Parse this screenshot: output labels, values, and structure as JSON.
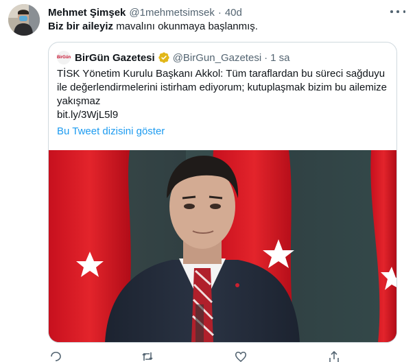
{
  "tweet": {
    "author_name": "Mehmet Şimşek",
    "author_handle": "@1mehmetsimsek",
    "separator": "·",
    "time": "40d",
    "text_bold": "Biz bir aileyiz",
    "text_rest": " mavalını okunmaya başlanmış."
  },
  "quote": {
    "logo_text": "BirGün",
    "author_name": "BirGün Gazetesi",
    "author_handle": "@BirGun_Gazetesi",
    "separator": "·",
    "time": "1 sa",
    "text": "TİSK Yönetim Kurulu Başkanı Akkol: Tüm taraflardan bu süreci sağduyu ile değerlendirmelerini istirham ediyorum; kutuplaşmak bizim bu ailemize yakışmaz",
    "link": "bit.ly/3WjL5l9",
    "show_thread": "Bu Tweet dizisini göster"
  },
  "icons": [
    "more-icon",
    "verified-badge-icon",
    "reply-icon",
    "retweet-icon",
    "like-icon",
    "share-icon"
  ],
  "colors": {
    "link_blue": "#1d9bf0",
    "muted": "#536471",
    "border": "#cfd9de",
    "verified_gold": "#e2b719"
  }
}
